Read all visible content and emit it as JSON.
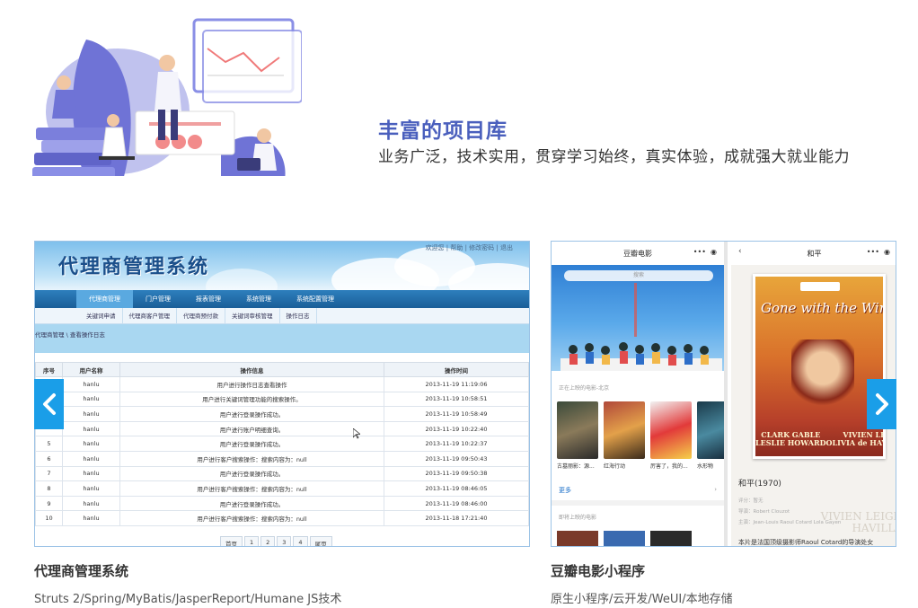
{
  "hero": {
    "title": "丰富的项目库",
    "subtitle": "业务广泛，技术实用，贯穿学习始终，真实体验，成就强大就业能力"
  },
  "projects": [
    {
      "title": "代理商管理系统",
      "description": "Struts 2/Spring/MyBatis/JasperReport/Humane JS技术",
      "screenshot": {
        "logo": "代理商管理系统",
        "top_links": "欢迎您 | 帮助 | 修改密码 | 退出",
        "main_nav": [
          "代理商管理",
          "门户管理",
          "报表管理",
          "系统管理",
          "系统配置管理"
        ],
        "sub_nav": [
          "关键词申请",
          "代理商客户管理",
          "代理商预付款",
          "关键词审核管理",
          "操作日志"
        ],
        "breadcrumb": "代理商管理 \\ 查看操作日志",
        "columns": [
          "序号",
          "用户名称",
          "操作信息",
          "操作时间"
        ],
        "rows": [
          [
            "",
            "hanlu",
            "用户进行操作日志查看操作",
            "2013-11-19 11:19:06"
          ],
          [
            "",
            "hanlu",
            "用户进行关键词管理功能的搜索操作。",
            "2013-11-19 10:58:51"
          ],
          [
            "",
            "hanlu",
            "用户进行登录操作成功。",
            "2013-11-19 10:58:49"
          ],
          [
            "",
            "hanlu",
            "用户进行账户明细查询。",
            "2013-11-19 10:22:40"
          ],
          [
            "5",
            "hanlu",
            "用户进行登录操作成功。",
            "2013-11-19 10:22:37"
          ],
          [
            "6",
            "hanlu",
            "用户进行客户搜索操作：搜索内容为：null",
            "2013-11-19 09:50:43"
          ],
          [
            "7",
            "hanlu",
            "用户进行登录操作成功。",
            "2013-11-19 09:50:38"
          ],
          [
            "8",
            "hanlu",
            "用户进行客户搜索操作：搜索内容为：null",
            "2013-11-19 08:46:05"
          ],
          [
            "9",
            "hanlu",
            "用户进行登录操作成功。",
            "2013-11-19 08:46:00"
          ],
          [
            "10",
            "hanlu",
            "用户进行客户搜索操作：搜索内容为：null",
            "2013-11-18 17:21:40"
          ]
        ],
        "pager": [
          "首页",
          "1",
          "2",
          "3",
          "4",
          "尾页"
        ]
      }
    },
    {
      "title": "豆瓣电影小程序",
      "description": "原生小程序/云开发/WeUI/本地存储",
      "screenshot": {
        "left_title": "豆瓣电影",
        "search_placeholder": "搜索",
        "section_now": "正在上映的电影-北京",
        "posters": [
          "古墓丽影：源...",
          "红海行动",
          "厉害了，我的...",
          "水形物"
        ],
        "more": "更多",
        "section_coming": "即将上映的电影",
        "right_title": "和平",
        "poster_title": "Gone with the Wind",
        "cast_left": "CLARK GABLE\nLESLIE HOWARD",
        "cast_right": "VIVIEN LEIGH\nOLIVIA de HAVILLAND",
        "movie_name": "和平(1970)",
        "meta1": "评分：暂无",
        "meta2": "导演：Robert Clouzot",
        "meta3": "主演：Jean-Louis Raoul Cotard Lola Gayen",
        "synopsis": "本片是法国顶级摄影师Raoul Cotard的导演处女",
        "watermark": "VIVIEN LEIGH\nHAVILLA"
      }
    }
  ],
  "colors": {
    "accent": "#4a5fbd",
    "arrow": "#1a9ee8"
  }
}
